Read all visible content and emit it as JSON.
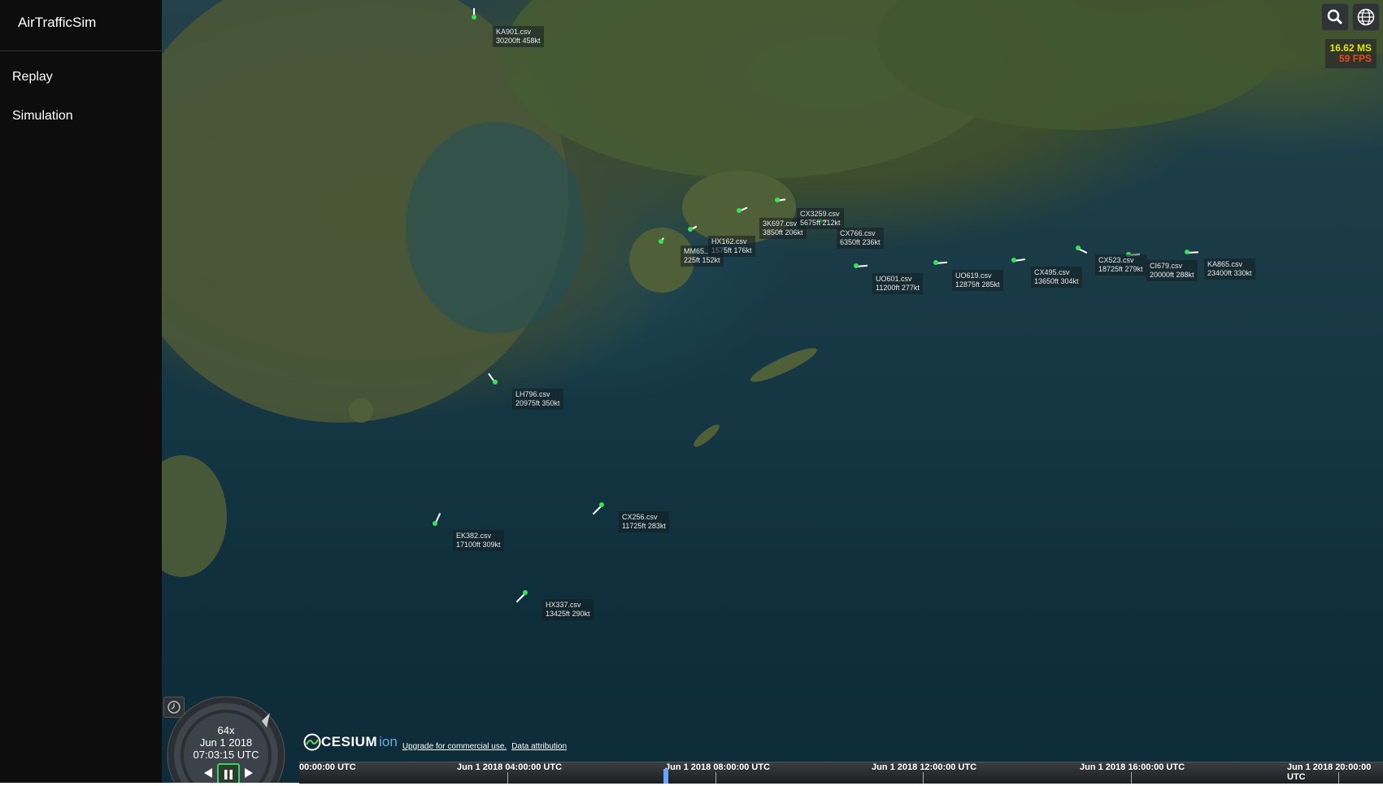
{
  "app": {
    "title": "AirTrafficSim"
  },
  "sidebar": {
    "items": [
      {
        "label": "Replay"
      },
      {
        "label": "Simulation"
      }
    ]
  },
  "performance": {
    "ms": "16.62 MS",
    "fps": "59 FPS"
  },
  "toolbar": {
    "icons": [
      "search-icon",
      "globe-icon"
    ]
  },
  "animation": {
    "speed": "64x",
    "date": "Jun 1 2018",
    "time": "07:03:15 UTC"
  },
  "credits": {
    "logo": "CESIUM",
    "ion": "ion",
    "upgrade": "Upgrade for commercial use.",
    "attribution": "Data attribution"
  },
  "timeline": {
    "ticks": [
      "00:00:00 UTC",
      "Jun 1 2018 04:00:00 UTC",
      "Jun 1 2018 08:00:00 UTC",
      "Jun 1 2018 12:00:00 UTC",
      "Jun 1 2018 16:00:00 UTC",
      "Jun 1 2018 20:00:00 UTC"
    ]
  },
  "aircraft": [
    {
      "name": "KA901.csv",
      "info": "30200ft 458kt"
    },
    {
      "name": "3K697.csv",
      "info": "3850ft 206kt"
    },
    {
      "name": "CX3259.csv",
      "info": "5675ft 212kt"
    },
    {
      "name": "CX766.csv",
      "info": "6350ft 236kt"
    },
    {
      "name": "HX162.csv",
      "info": "1575ft 176kt"
    },
    {
      "name": "MM65..",
      "info": "225ft 152kt"
    },
    {
      "name": "UO601.csv",
      "info": "11200ft 277kt"
    },
    {
      "name": "UO619.csv",
      "info": "12875ft 285kt"
    },
    {
      "name": "CX495.csv",
      "info": "13650ft 304kt"
    },
    {
      "name": "CX523.csv",
      "info": "18725ft 279kt"
    },
    {
      "name": "CI679.csv",
      "info": "20000ft 288kt"
    },
    {
      "name": "KA865.csv",
      "info": "23400ft 330kt"
    },
    {
      "name": "LH796.csv",
      "info": "20975ft 350kt"
    },
    {
      "name": "CX256.csv",
      "info": "11725ft 283kt"
    },
    {
      "name": "EK382.csv",
      "info": "17100ft 309kt"
    },
    {
      "name": "HX337.csv",
      "info": "13425ft 290kt"
    }
  ]
}
